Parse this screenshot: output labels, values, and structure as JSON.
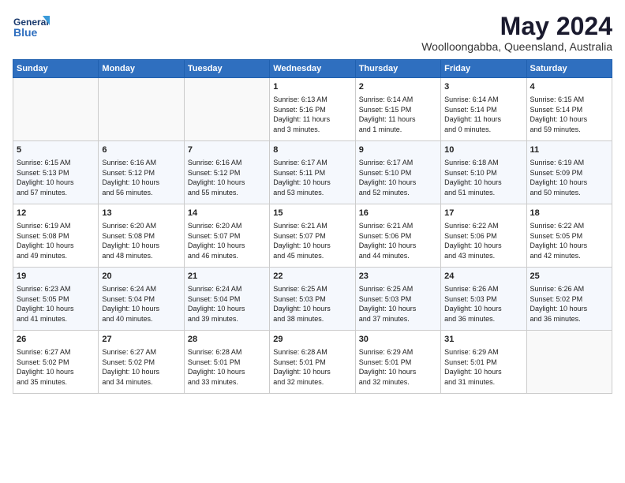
{
  "header": {
    "logo_line1": "General",
    "logo_line2": "Blue",
    "month_title": "May 2024",
    "location": "Woolloongabba, Queensland, Australia"
  },
  "weekdays": [
    "Sunday",
    "Monday",
    "Tuesday",
    "Wednesday",
    "Thursday",
    "Friday",
    "Saturday"
  ],
  "weeks": [
    [
      {
        "day": "",
        "info": ""
      },
      {
        "day": "",
        "info": ""
      },
      {
        "day": "",
        "info": ""
      },
      {
        "day": "1",
        "info": "Sunrise: 6:13 AM\nSunset: 5:16 PM\nDaylight: 11 hours\nand 3 minutes."
      },
      {
        "day": "2",
        "info": "Sunrise: 6:14 AM\nSunset: 5:15 PM\nDaylight: 11 hours\nand 1 minute."
      },
      {
        "day": "3",
        "info": "Sunrise: 6:14 AM\nSunset: 5:14 PM\nDaylight: 11 hours\nand 0 minutes."
      },
      {
        "day": "4",
        "info": "Sunrise: 6:15 AM\nSunset: 5:14 PM\nDaylight: 10 hours\nand 59 minutes."
      }
    ],
    [
      {
        "day": "5",
        "info": "Sunrise: 6:15 AM\nSunset: 5:13 PM\nDaylight: 10 hours\nand 57 minutes."
      },
      {
        "day": "6",
        "info": "Sunrise: 6:16 AM\nSunset: 5:12 PM\nDaylight: 10 hours\nand 56 minutes."
      },
      {
        "day": "7",
        "info": "Sunrise: 6:16 AM\nSunset: 5:12 PM\nDaylight: 10 hours\nand 55 minutes."
      },
      {
        "day": "8",
        "info": "Sunrise: 6:17 AM\nSunset: 5:11 PM\nDaylight: 10 hours\nand 53 minutes."
      },
      {
        "day": "9",
        "info": "Sunrise: 6:17 AM\nSunset: 5:10 PM\nDaylight: 10 hours\nand 52 minutes."
      },
      {
        "day": "10",
        "info": "Sunrise: 6:18 AM\nSunset: 5:10 PM\nDaylight: 10 hours\nand 51 minutes."
      },
      {
        "day": "11",
        "info": "Sunrise: 6:19 AM\nSunset: 5:09 PM\nDaylight: 10 hours\nand 50 minutes."
      }
    ],
    [
      {
        "day": "12",
        "info": "Sunrise: 6:19 AM\nSunset: 5:08 PM\nDaylight: 10 hours\nand 49 minutes."
      },
      {
        "day": "13",
        "info": "Sunrise: 6:20 AM\nSunset: 5:08 PM\nDaylight: 10 hours\nand 48 minutes."
      },
      {
        "day": "14",
        "info": "Sunrise: 6:20 AM\nSunset: 5:07 PM\nDaylight: 10 hours\nand 46 minutes."
      },
      {
        "day": "15",
        "info": "Sunrise: 6:21 AM\nSunset: 5:07 PM\nDaylight: 10 hours\nand 45 minutes."
      },
      {
        "day": "16",
        "info": "Sunrise: 6:21 AM\nSunset: 5:06 PM\nDaylight: 10 hours\nand 44 minutes."
      },
      {
        "day": "17",
        "info": "Sunrise: 6:22 AM\nSunset: 5:06 PM\nDaylight: 10 hours\nand 43 minutes."
      },
      {
        "day": "18",
        "info": "Sunrise: 6:22 AM\nSunset: 5:05 PM\nDaylight: 10 hours\nand 42 minutes."
      }
    ],
    [
      {
        "day": "19",
        "info": "Sunrise: 6:23 AM\nSunset: 5:05 PM\nDaylight: 10 hours\nand 41 minutes."
      },
      {
        "day": "20",
        "info": "Sunrise: 6:24 AM\nSunset: 5:04 PM\nDaylight: 10 hours\nand 40 minutes."
      },
      {
        "day": "21",
        "info": "Sunrise: 6:24 AM\nSunset: 5:04 PM\nDaylight: 10 hours\nand 39 minutes."
      },
      {
        "day": "22",
        "info": "Sunrise: 6:25 AM\nSunset: 5:03 PM\nDaylight: 10 hours\nand 38 minutes."
      },
      {
        "day": "23",
        "info": "Sunrise: 6:25 AM\nSunset: 5:03 PM\nDaylight: 10 hours\nand 37 minutes."
      },
      {
        "day": "24",
        "info": "Sunrise: 6:26 AM\nSunset: 5:03 PM\nDaylight: 10 hours\nand 36 minutes."
      },
      {
        "day": "25",
        "info": "Sunrise: 6:26 AM\nSunset: 5:02 PM\nDaylight: 10 hours\nand 36 minutes."
      }
    ],
    [
      {
        "day": "26",
        "info": "Sunrise: 6:27 AM\nSunset: 5:02 PM\nDaylight: 10 hours\nand 35 minutes."
      },
      {
        "day": "27",
        "info": "Sunrise: 6:27 AM\nSunset: 5:02 PM\nDaylight: 10 hours\nand 34 minutes."
      },
      {
        "day": "28",
        "info": "Sunrise: 6:28 AM\nSunset: 5:01 PM\nDaylight: 10 hours\nand 33 minutes."
      },
      {
        "day": "29",
        "info": "Sunrise: 6:28 AM\nSunset: 5:01 PM\nDaylight: 10 hours\nand 32 minutes."
      },
      {
        "day": "30",
        "info": "Sunrise: 6:29 AM\nSunset: 5:01 PM\nDaylight: 10 hours\nand 32 minutes."
      },
      {
        "day": "31",
        "info": "Sunrise: 6:29 AM\nSunset: 5:01 PM\nDaylight: 10 hours\nand 31 minutes."
      },
      {
        "day": "",
        "info": ""
      }
    ]
  ]
}
